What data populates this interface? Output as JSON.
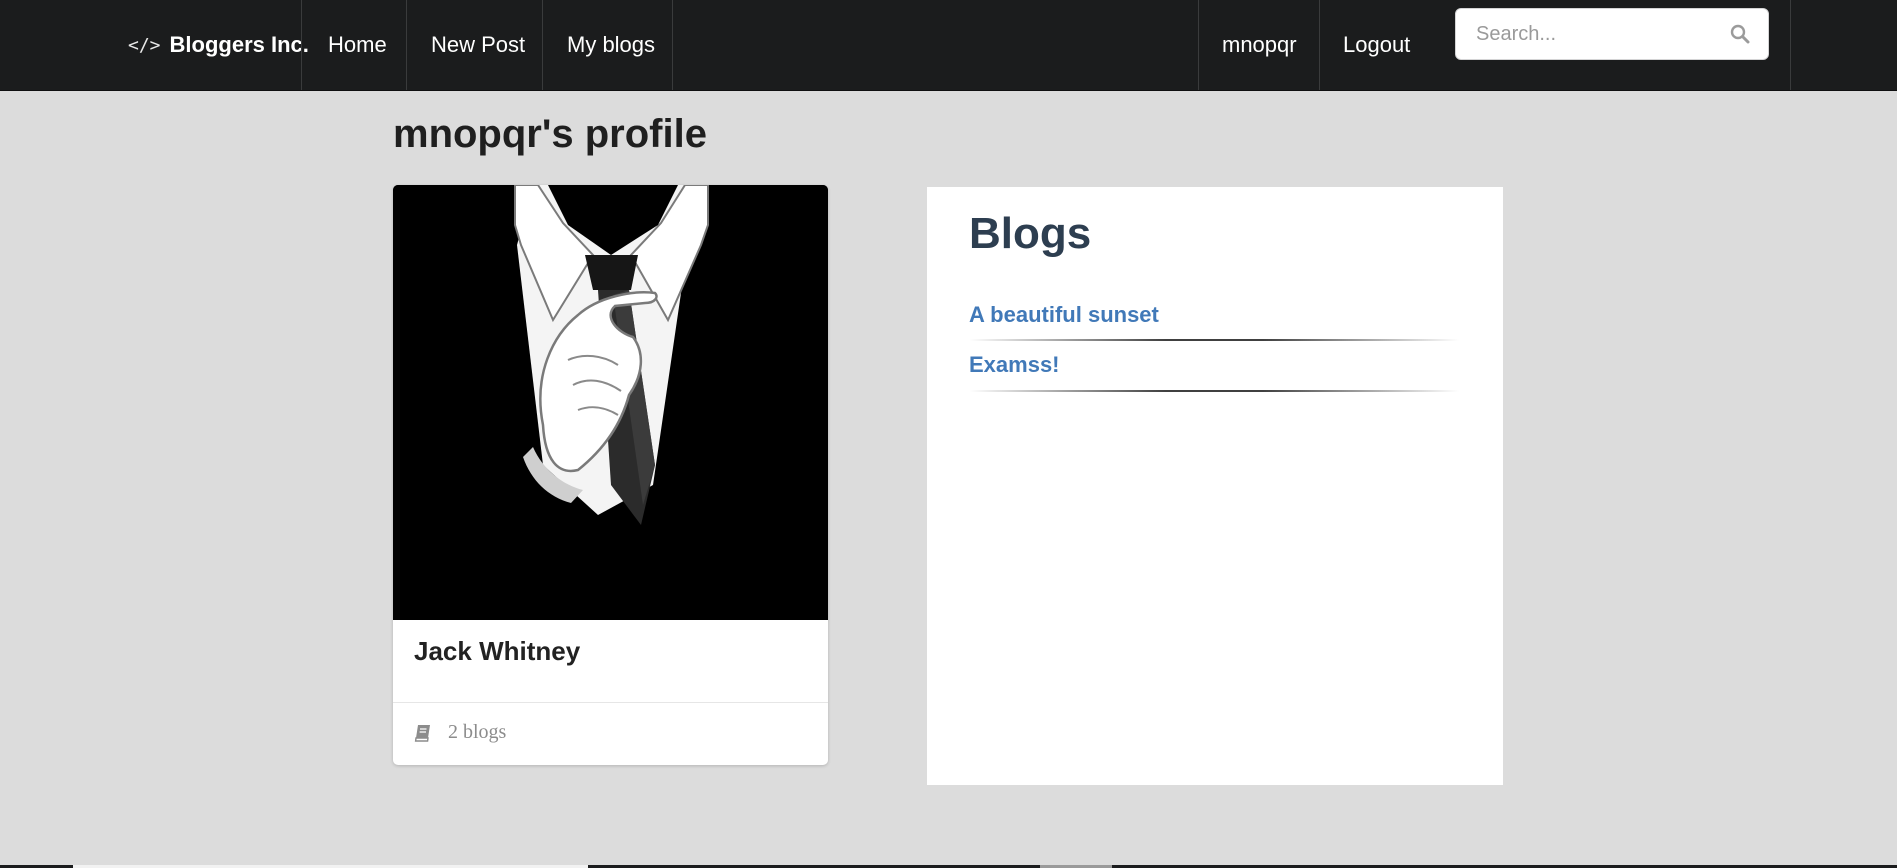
{
  "navbar": {
    "brand": "Bloggers Inc.",
    "brand_icon": "code-icon",
    "links": [
      "Home",
      "New Post",
      "My blogs"
    ],
    "user": "mnopqr",
    "logout": "Logout",
    "search_placeholder": "Search...",
    "search_icon": "search-icon"
  },
  "page": {
    "title": "mnopqr's profile"
  },
  "profile": {
    "name": "Jack Whitney",
    "blog_count": "2 blogs",
    "blog_count_icon": "book-icon",
    "avatar": "suit-and-tie-illustration"
  },
  "blogs": {
    "heading": "Blogs",
    "items": [
      "A beautiful sunset",
      "Examss!"
    ]
  },
  "colors": {
    "navbar_bg": "#1b1c1d",
    "page_bg": "#dcdcdc",
    "link": "#4179b8",
    "heading": "#2d3e50"
  }
}
